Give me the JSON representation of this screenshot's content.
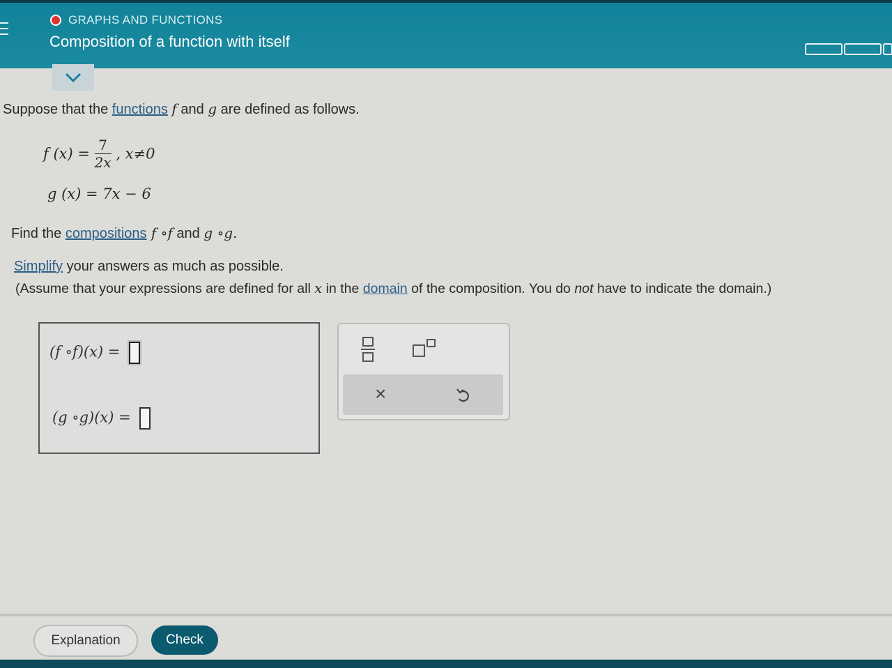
{
  "header": {
    "topic": "GRAPHS AND FUNCTIONS",
    "title": "Composition of a function with itself",
    "accent_color": "#17879d",
    "status_color": "#e0342c"
  },
  "problem": {
    "intro_1": "Suppose that the ",
    "intro_link": "functions",
    "intro_2": " and ",
    "intro_3": " are defined as follows.",
    "f_name": "f",
    "g_name": "g",
    "f_lhs": "f (x) =",
    "f_num": "7",
    "f_den": "2x",
    "f_cond": ", x≠0",
    "g_def": "g (x) = 7x − 6",
    "find_1": "Find the ",
    "find_link": "compositions",
    "find_expr_1": " f ∘f",
    "find_and": " and ",
    "find_expr_2": "g ∘g.",
    "simplify_link": "Simplify",
    "simplify_rest": " your answers as much as possible.",
    "assume_1": "(Assume that your expressions are defined for all ",
    "assume_x": "x",
    "assume_2": " in the ",
    "assume_link": "domain",
    "assume_3": " of the composition. You do ",
    "assume_not": "not",
    "assume_4": " have to indicate the domain.)"
  },
  "answers": {
    "fof_label": "(f ∘f)(x) =",
    "gog_label": "(g ∘g)(x) =",
    "fof_value": "",
    "gog_value": ""
  },
  "keypad": {
    "fraction_icon": "fraction-icon",
    "exponent_icon": "exponent-icon",
    "clear_label": "×",
    "undo_icon": "undo-icon"
  },
  "footer": {
    "explanation_label": "Explanation",
    "check_label": "Check"
  }
}
